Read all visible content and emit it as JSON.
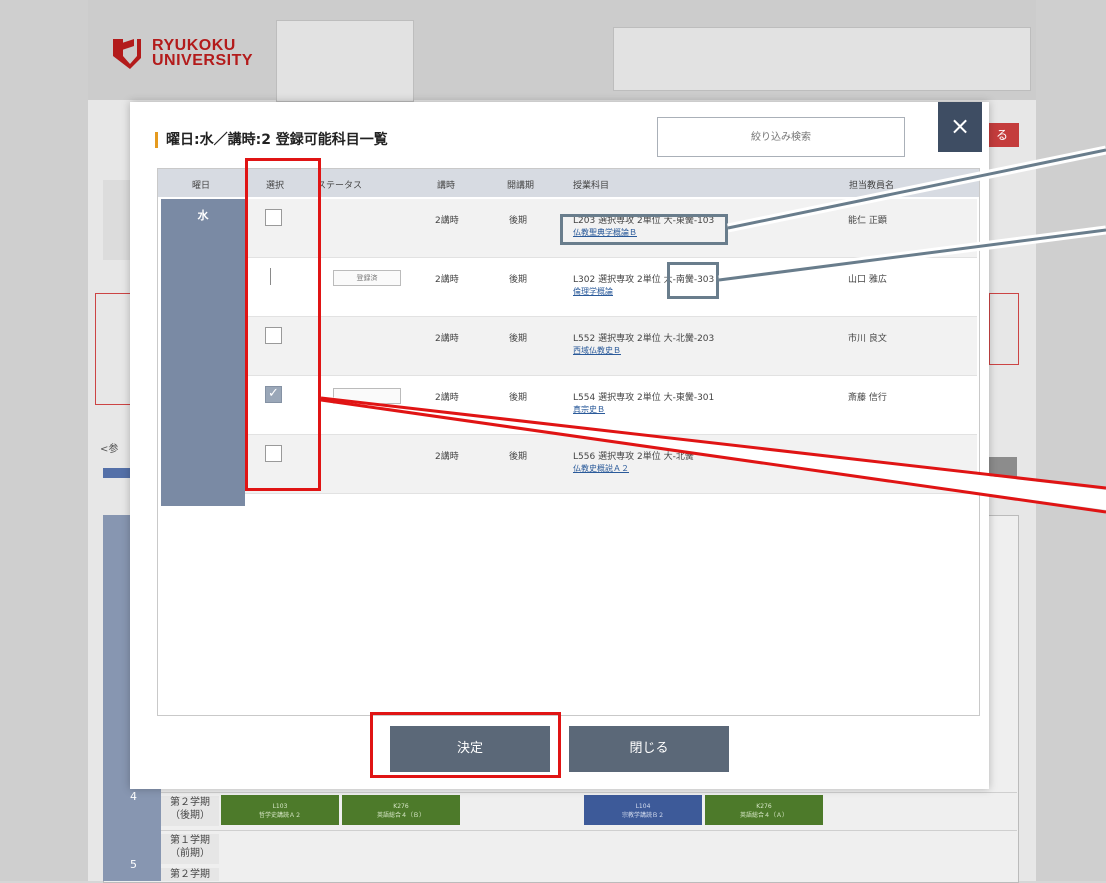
{
  "header": {
    "university_line1": "RYUKOKU",
    "university_line2": "UNIVERSITY"
  },
  "background": {
    "red_button_label": "る",
    "reference_label": "<参",
    "row_number_4": "4",
    "row_number_5": "5",
    "term_rows": [
      "第２学期（後期）",
      "第１学期（前期）",
      "第２学期"
    ],
    "green_cells": [
      {
        "code": "L103",
        "name": "哲学史講読Ａ２"
      },
      {
        "code": "K276",
        "name": "英語総合４（Ｂ）"
      },
      {
        "code": "K276",
        "name": "英語総合４（Ａ）"
      }
    ],
    "navy_cells": [
      {
        "code": "L104",
        "name": "宗教学講読Ｂ２"
      }
    ]
  },
  "modal": {
    "title": "曜日:水／講時:2 登録可能科目一覧",
    "filter_placeholder": "絞り込み検索",
    "close_icon": "×",
    "columns": [
      "曜日",
      "選択",
      "ステータス",
      "講時",
      "開講期",
      "授業科目",
      "担当教員名"
    ],
    "day": "水",
    "rows": [
      {
        "status": "",
        "period": "2講時",
        "term": "後期",
        "code": "L203",
        "type": "選択専攻",
        "units": "2単位",
        "room": "大-東黌-103",
        "course": "仏教聖典学概論Ｂ",
        "teacher": "能仁 正顕",
        "checkbox": "empty"
      },
      {
        "status": "登録済",
        "period": "2講時",
        "term": "後期",
        "code": "L302",
        "type": "選択専攻",
        "units": "2単位",
        "room": "大-南黌-303",
        "course": "倫理学概論",
        "teacher": "山口 雅広",
        "checkbox": "none"
      },
      {
        "status": "",
        "period": "2講時",
        "term": "後期",
        "code": "L552",
        "type": "選択専攻",
        "units": "2単位",
        "room": "大-北黌-203",
        "course": "西域仏教史Ｂ",
        "teacher": "市川 良文",
        "checkbox": "empty"
      },
      {
        "status": "",
        "period": "2講時",
        "term": "後期",
        "code": "L554",
        "type": "選択専攻",
        "units": "2単位",
        "room": "大-東黌-301",
        "course": "真宗史Ｂ",
        "teacher": "斎藤 信行",
        "checkbox": "checked"
      },
      {
        "status": "",
        "period": "2講時",
        "term": "後期",
        "code": "L556",
        "type": "選択専攻",
        "units": "2単位",
        "room": "大-北黌",
        "course": "仏教史概説Ａ２",
        "teacher": "",
        "checkbox": "empty"
      }
    ],
    "decide_label": "決定",
    "close_label": "閉じる"
  },
  "colors": {
    "accent_orange": "#e59a1f",
    "annotation_red": "#e01414",
    "annotation_grey": "#697d8c",
    "button_bg": "#5b6878",
    "day_column": "#7a8aa4"
  }
}
